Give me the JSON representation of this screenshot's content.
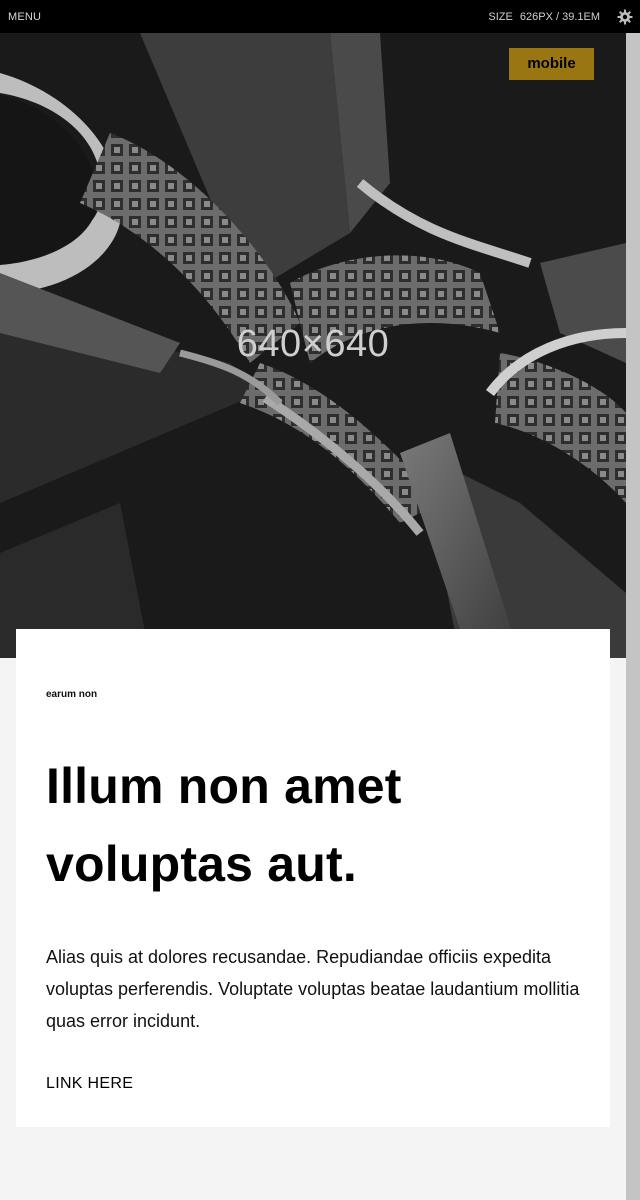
{
  "topbar": {
    "menu_label": "MENU",
    "size_label": "SIZE",
    "size_px": "626PX / 39.1EM",
    "settings_icon": "gear-icon"
  },
  "hero": {
    "placeholder_label": "640×640",
    "badge_label": "mobile"
  },
  "card": {
    "eyebrow": "earum non",
    "headline": "Illum non amet voluptas aut.",
    "body": "Alias quis at dolores recusandae. Repudiandae officiis expedita voluptas perferendis. Voluptate voluptas beatae laudantium mollitia quas error incidunt.",
    "link_label": "LINK HERE"
  },
  "colors": {
    "accent": "#9a7613",
    "topbar_bg": "#000000",
    "page_bg": "#f4f4f4",
    "card_bg": "#ffffff"
  }
}
